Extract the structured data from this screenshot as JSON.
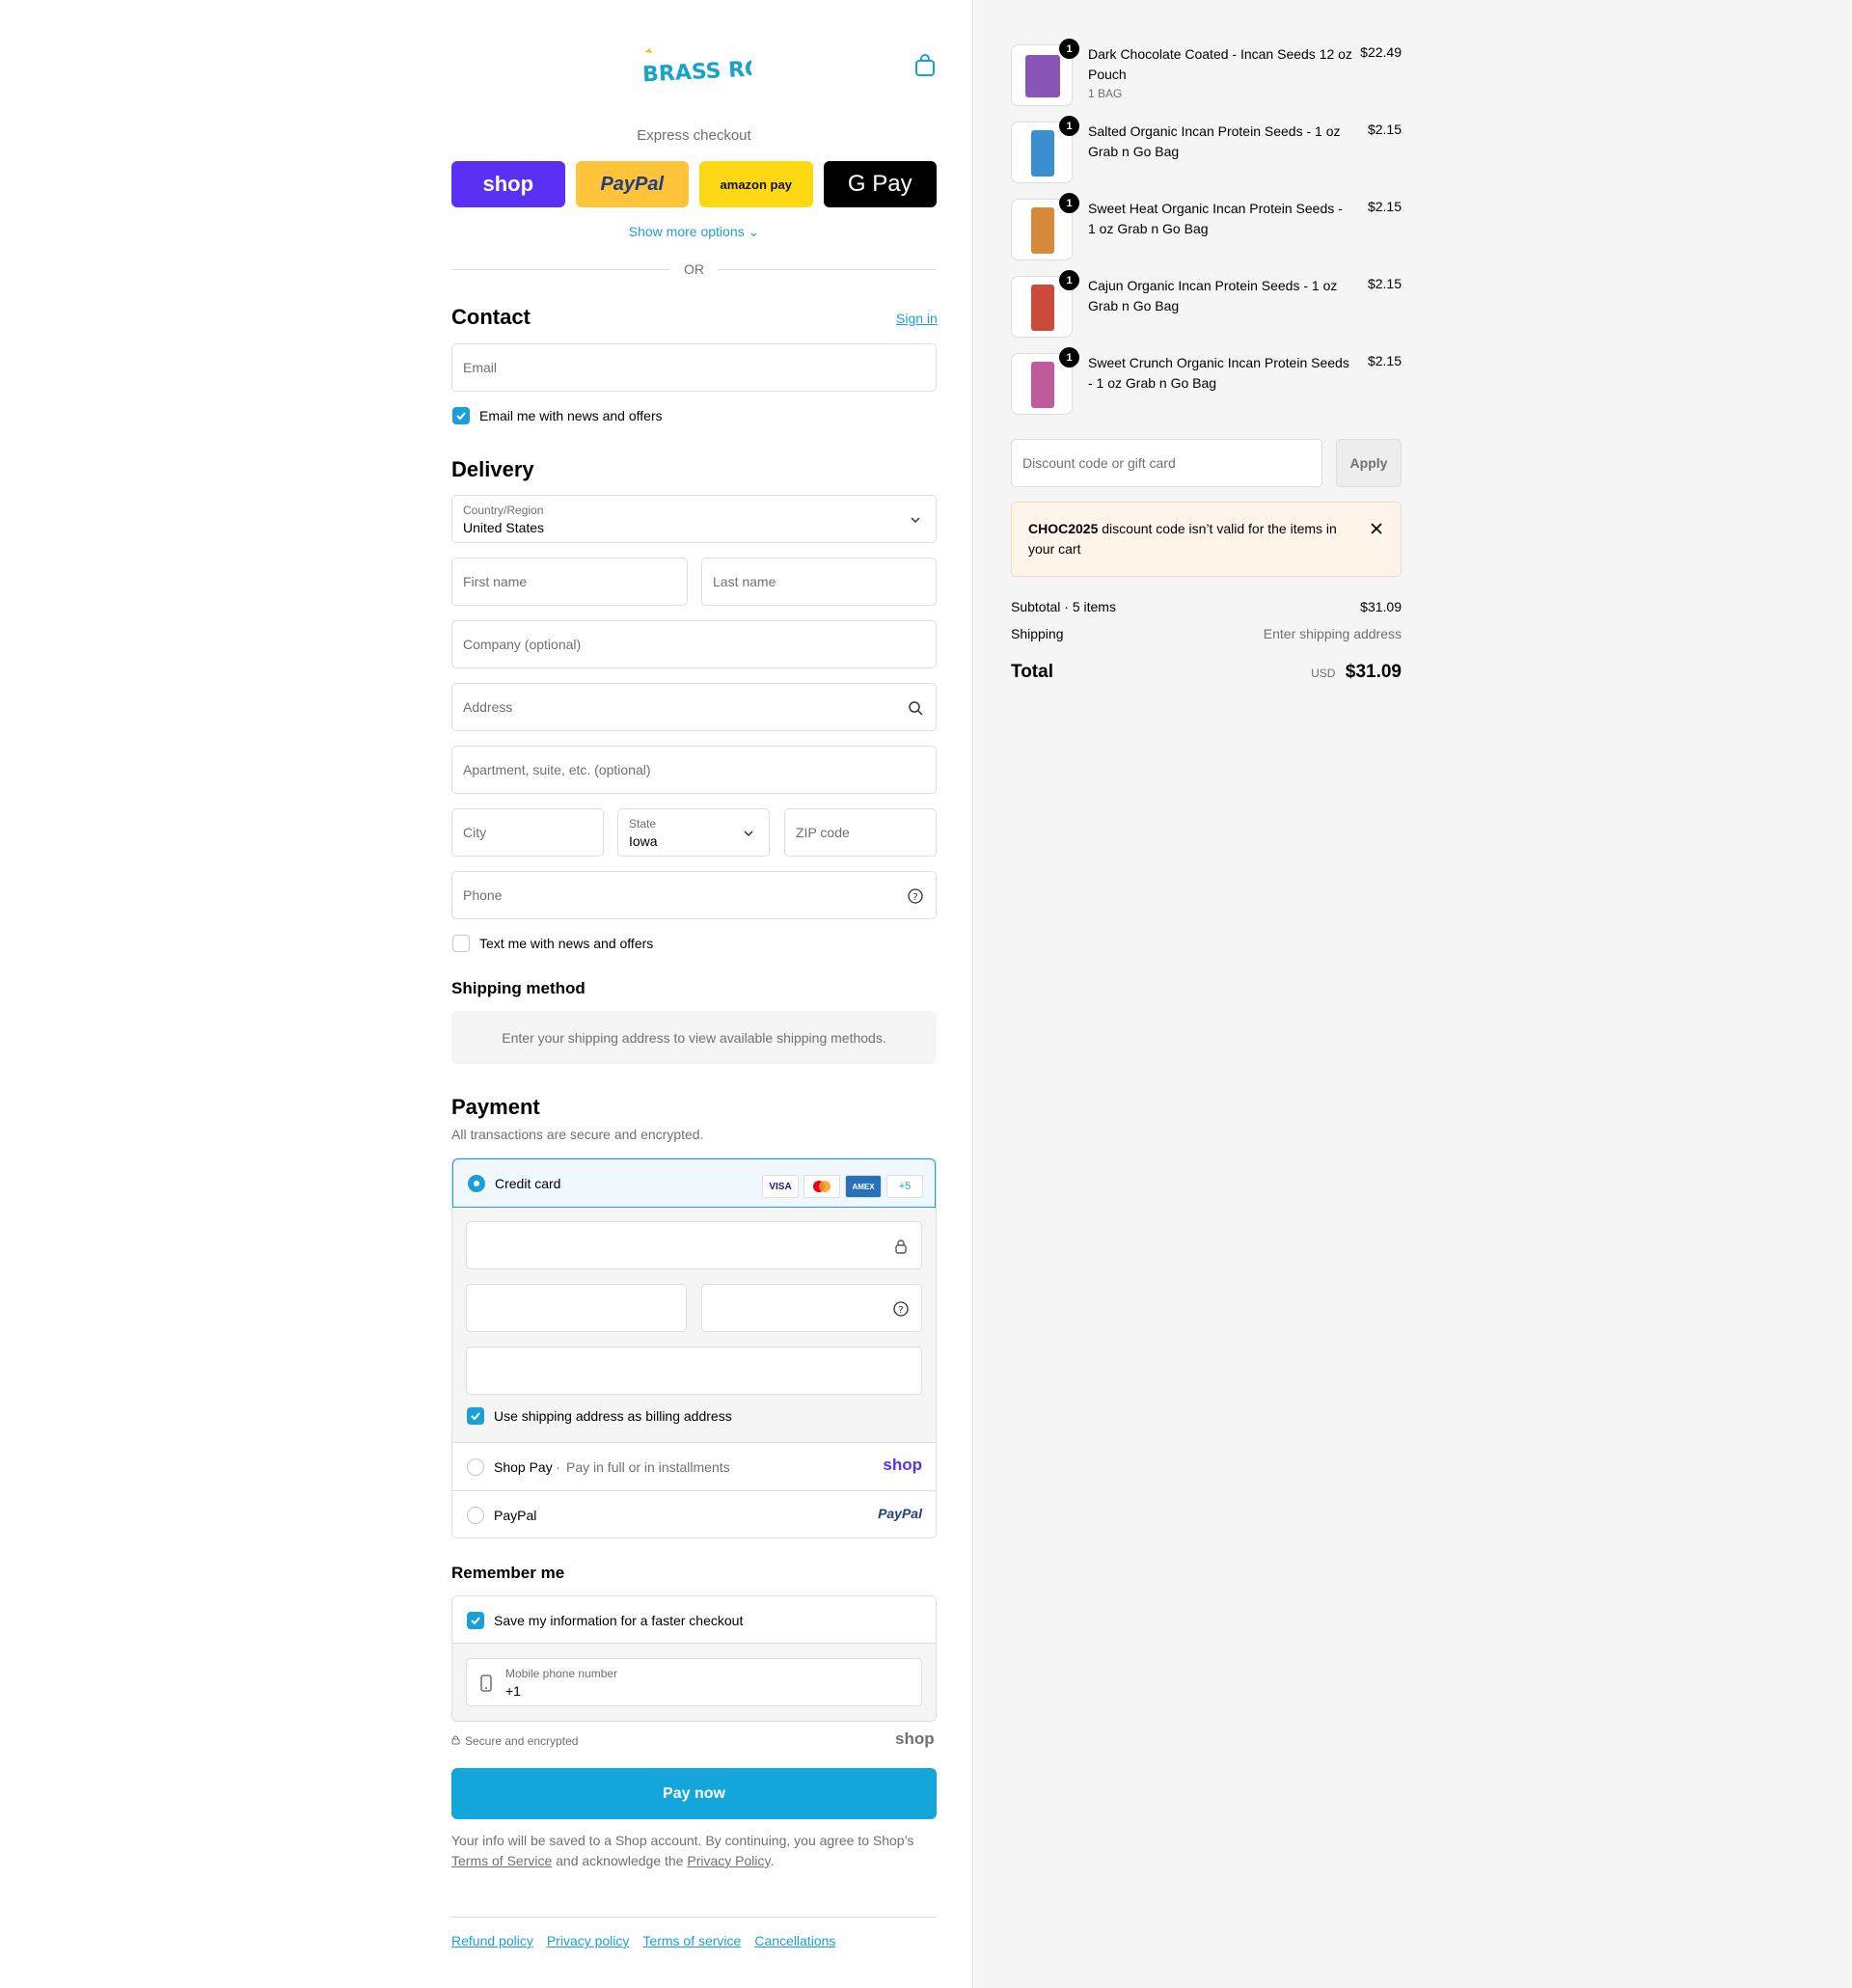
{
  "header": {
    "brand": "BRASS ROOTS"
  },
  "express": {
    "label": "Express checkout",
    "buttons": [
      {
        "label": "shop",
        "color": "#5a31f4"
      },
      {
        "label": "PayPal",
        "color": "#ffc43a"
      },
      {
        "label": "amazon pay",
        "color": "#ffd814"
      },
      {
        "label": "G Pay",
        "color": "#000000"
      }
    ],
    "show_more": "Show more options",
    "or": "OR"
  },
  "contact": {
    "title": "Contact",
    "sign_in": "Sign in",
    "email_placeholder": "Email",
    "news_label": "Email me with news and offers",
    "news_checked": true
  },
  "delivery": {
    "title": "Delivery",
    "country_label": "Country/Region",
    "country_value": "United States",
    "first_name": "First name",
    "last_name": "Last name",
    "company": "Company (optional)",
    "address": "Address",
    "apartment": "Apartment, suite, etc. (optional)",
    "city": "City",
    "state_label": "State",
    "state_value": "Iowa",
    "zip": "ZIP code",
    "phone": "Phone",
    "text_label": "Text me with news and offers",
    "text_checked": false
  },
  "shipping_method": {
    "title": "Shipping method",
    "message": "Enter your shipping address to view available shipping methods."
  },
  "payment": {
    "title": "Payment",
    "subtitle": "All transactions are secure and encrypted.",
    "credit_card": "Credit card",
    "card_brands": [
      "VISA",
      "MC",
      "AMEX",
      "+5"
    ],
    "billing_label": "Use shipping address as billing address",
    "shop_pay": "Shop Pay",
    "shop_pay_desc": "Pay in full or in installments",
    "shop_pay_logo": "shop",
    "paypal": "PayPal",
    "paypal_logo": "PayPal"
  },
  "remember": {
    "title": "Remember me",
    "save_label": "Save my information for a faster checkout",
    "mobile_label": "Mobile phone number",
    "mobile_value": "+1",
    "secure": "Secure and encrypted",
    "shop_logo": "shop"
  },
  "pay_now": "Pay now",
  "legal": {
    "before": "Your info will be saved to a Shop account. By continuing, you agree to Shop’s",
    "terms": "Terms of Service",
    "middle": "and acknowledge the",
    "privacy": "Privacy Policy",
    "end": "."
  },
  "footer": [
    "Refund policy",
    "Privacy policy",
    "Terms of service",
    "Cancellations"
  ],
  "cart": {
    "items": [
      {
        "name": "Dark Chocolate Coated - Incan Seeds 12 oz Pouch",
        "variant": "1 BAG",
        "price": "$22.49",
        "qty": "1",
        "color": "#8a55b8"
      },
      {
        "name": "Salted Organic Incan Protein Seeds - 1 oz Grab n Go Bag",
        "variant": "",
        "price": "$2.15",
        "qty": "1",
        "color": "#3b8fd0"
      },
      {
        "name": "Sweet Heat Organic Incan Protein Seeds - 1 oz Grab n Go Bag",
        "variant": "",
        "price": "$2.15",
        "qty": "1",
        "color": "#d8893a"
      },
      {
        "name": "Cajun Organic Incan Protein Seeds - 1 oz Grab n Go Bag",
        "variant": "",
        "price": "$2.15",
        "qty": "1",
        "color": "#cc4a3a"
      },
      {
        "name": "Sweet Crunch Organic Incan Protein Seeds - 1 oz Grab n Go Bag",
        "variant": "",
        "price": "$2.15",
        "qty": "1",
        "color": "#c05a9a"
      }
    ],
    "discount_placeholder": "Discount code or gift card",
    "apply": "Apply",
    "alert_code": "CHOC2025",
    "alert_text": "discount code isn’t valid for the items in your cart",
    "subtotal_label": "Subtotal · 5 items",
    "subtotal_value": "$31.09",
    "shipping_label": "Shipping",
    "shipping_value": "Enter shipping address",
    "total_label": "Total",
    "currency": "USD",
    "total_value": "$31.09"
  },
  "colors": {
    "accent": "#1a9fd8",
    "pay_button": "#12a6db"
  }
}
